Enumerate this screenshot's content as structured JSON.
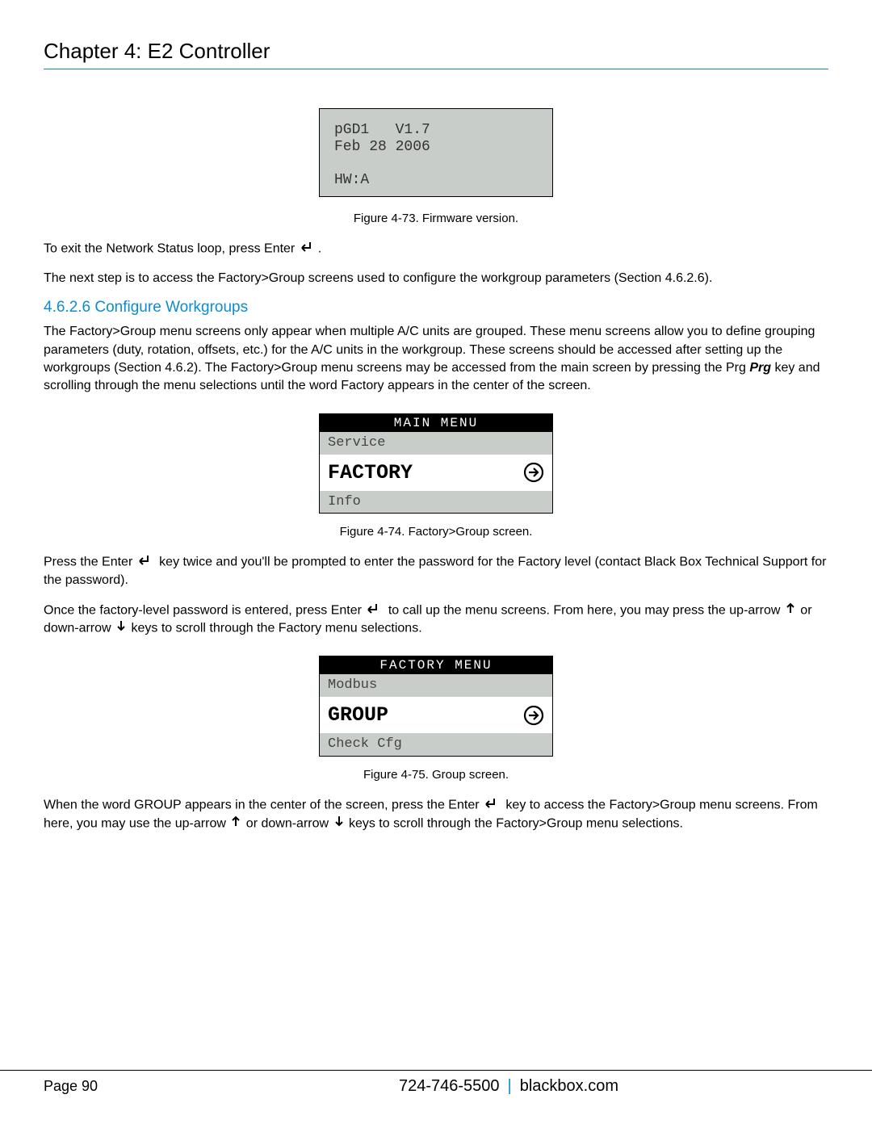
{
  "chapter": "Chapter 4: E2 Controller",
  "fig73": {
    "lcd_line1": "pGD1   V1.7",
    "lcd_line2": "Feb 28 2006",
    "lcd_line3": "HW:A",
    "caption": "Figure 4-73. Firmware version."
  },
  "p_exit_pre": "To exit the Network Status loop, press Enter ",
  "p_exit_post": ".",
  "p_next": "The next step is to access the Factory>Group screens used to configure the workgroup parameters (Section 4.6.2.6).",
  "section_heading": "4.6.2.6 Configure Workgroups",
  "p_cfg_pre": "The Factory>Group menu screens only appear when multiple A/C units are grouped. These menu screens allow you to define grouping parameters (duty, rotation, offsets, etc.) for the A/C units in the workgroup. These screens should be accessed after setting up the workgroups (Section 4.6.2). The Factory>Group menu screens may be accessed from the main screen by pressing the Prg ",
  "prg_label": "Prg",
  "p_cfg_post": " key and scrolling through the menu selections until the word Factory appears in the center of the screen.",
  "fig74": {
    "header": "MAIN MENU",
    "row_top": "Service",
    "selected": "FACTORY",
    "row_bottom": "Info",
    "caption": "Figure 4-74. Factory>Group screen."
  },
  "p_press_pre": "Press the Enter ",
  "p_press_post": " key twice and you'll be prompted to enter the password for the Factory level (contact Black Box Technical Support for the password).",
  "p_once_pre": "Once the factory-level password is entered, press Enter ",
  "p_once_mid1": " to call up the menu screens. From here, you may press the up-arrow ",
  "p_once_mid2": " or down-arrow ",
  "p_once_post": " keys to scroll through the Factory menu selections.",
  "fig75": {
    "header": "FACTORY MENU",
    "row_top": "Modbus",
    "selected": "GROUP",
    "row_bottom": "Check Cfg",
    "caption": "Figure 4-75. Group screen."
  },
  "p_group_pre": "When the word GROUP appears in the center of the screen, press the Enter ",
  "p_group_mid1": " key to access the Factory>Group menu screens. From here, you may use the up-arrow ",
  "p_group_mid2": " or down-arrow ",
  "p_group_post": " keys to scroll through the Factory>Group menu selections.",
  "footer": {
    "page": "Page 90",
    "phone": "724-746-5500",
    "site": "blackbox.com"
  }
}
